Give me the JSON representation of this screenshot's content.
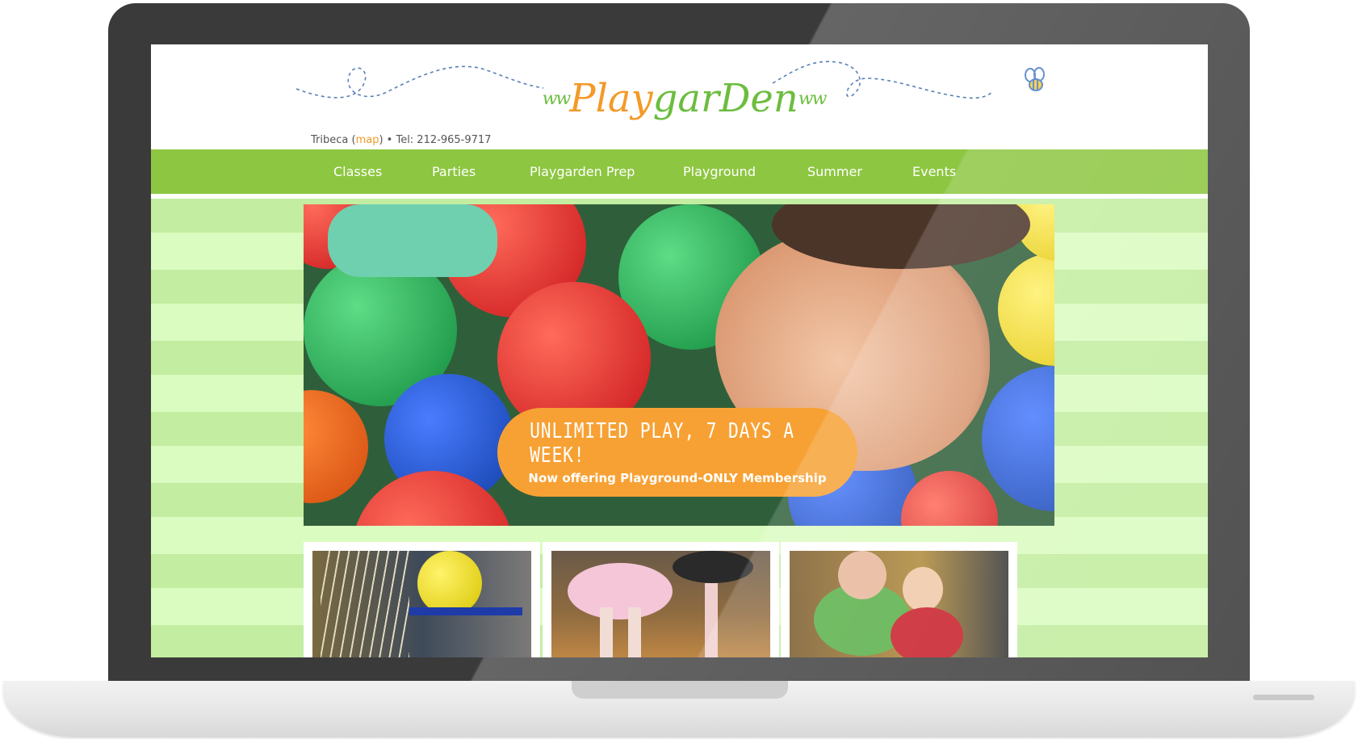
{
  "header": {
    "logo": {
      "prefix": "Play",
      "suffix": "garDen"
    },
    "location": "Tribeca (",
    "map_link": "map",
    "phone": ") • Tel: 212-965-9717"
  },
  "nav": {
    "items": [
      {
        "label": "Classes"
      },
      {
        "label": "Parties"
      },
      {
        "label": "Playgarden Prep"
      },
      {
        "label": "Playground"
      },
      {
        "label": "Summer"
      },
      {
        "label": "Events"
      }
    ]
  },
  "hero": {
    "headline": "UNLIMITED PLAY, 7 DAYS A WEEK!",
    "subline": "Now offering Playground-ONLY Membership"
  },
  "thumbnails": [
    {
      "subject": "child-with-yellow-ball"
    },
    {
      "subject": "ballet-tutus"
    },
    {
      "subject": "teacher-with-baby"
    }
  ],
  "colors": {
    "brand_green": "#8dc641",
    "brand_orange": "#f39a28",
    "stripe_dark": "#c3eda0",
    "stripe_light": "#dafcc0",
    "laptop_bezel": "#3a3a3a"
  }
}
